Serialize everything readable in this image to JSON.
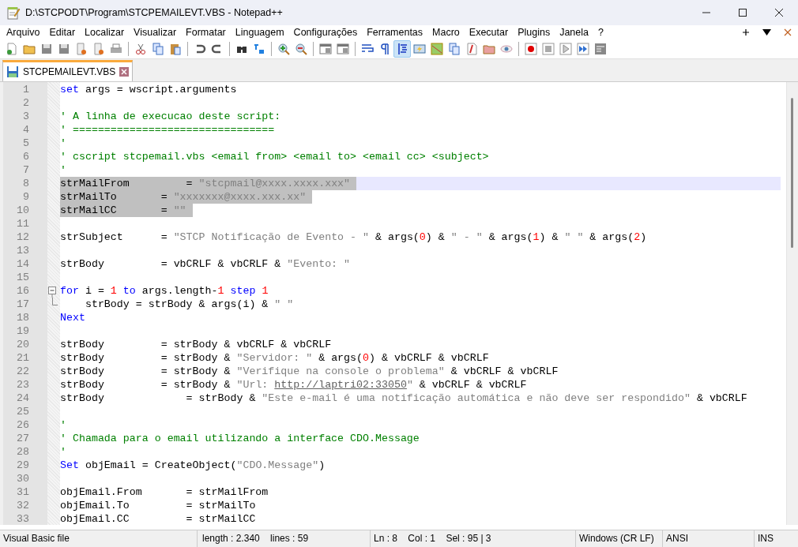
{
  "window": {
    "title": "D:\\STCPODT\\Program\\STCPEMAILEVT.VBS - Notepad++"
  },
  "menu": [
    {
      "label": "Arquivo"
    },
    {
      "label": "Editar"
    },
    {
      "label": "Localizar"
    },
    {
      "label": "Visualizar"
    },
    {
      "label": "Formatar"
    },
    {
      "label": "Linguagem"
    },
    {
      "label": "Configurações"
    },
    {
      "label": "Ferramentas"
    },
    {
      "label": "Macro"
    },
    {
      "label": "Executar"
    },
    {
      "label": "Plugins"
    },
    {
      "label": "Janela"
    },
    {
      "label": "?"
    }
  ],
  "toolbar": [
    {
      "pressed": false
    },
    {
      "pressed": false
    },
    {
      "pressed": false
    },
    {
      "pressed": false
    },
    {
      "pressed": false
    },
    {
      "pressed": false
    },
    {
      "pressed": false
    },
    {
      "pressed": false
    },
    {
      "pressed": false
    },
    {
      "pressed": false
    },
    {
      "pressed": false
    },
    {
      "pressed": false
    },
    {
      "pressed": false
    },
    {
      "pressed": false
    },
    {
      "pressed": false
    },
    {
      "pressed": false
    },
    {
      "pressed": false
    },
    {
      "pressed": false
    },
    {
      "pressed": false
    },
    {
      "pressed": false
    },
    {
      "pressed": true
    },
    {
      "pressed": false
    },
    {
      "pressed": false
    },
    {
      "pressed": false
    },
    {
      "pressed": false
    },
    {
      "pressed": false
    },
    {
      "pressed": false
    },
    {
      "pressed": false
    },
    {
      "pressed": false
    },
    {
      "pressed": false
    },
    {
      "pressed": false
    },
    {
      "pressed": false
    }
  ],
  "tabs": [
    {
      "label": "STCPEMAILEVT.VBS",
      "selected": true
    }
  ],
  "lines": [
    {
      "n": "1",
      "selected": false,
      "current": false,
      "tokens": [
        {
          "kind": "kw",
          "text": "set"
        },
        {
          "kind": "txt",
          "text": " args = wscript.arguments"
        }
      ]
    },
    {
      "n": "2",
      "selected": false,
      "current": false
    },
    {
      "n": "3",
      "selected": false,
      "current": false,
      "tokens": [
        {
          "kind": "cmt",
          "text": "' A linha de execucao deste script:"
        }
      ]
    },
    {
      "n": "4",
      "selected": false,
      "current": false,
      "tokens": [
        {
          "kind": "cmt",
          "text": "' ================================"
        }
      ]
    },
    {
      "n": "5",
      "selected": false,
      "current": false,
      "tokens": [
        {
          "kind": "cmt",
          "text": "'"
        }
      ]
    },
    {
      "n": "6",
      "selected": false,
      "current": false,
      "tokens": [
        {
          "kind": "cmt",
          "text": "' cscript stcpemail.vbs <email from> <email to> <email cc> <subject>"
        }
      ]
    },
    {
      "n": "7",
      "selected": false,
      "current": false,
      "tokens": [
        {
          "kind": "cmt",
          "text": "'"
        }
      ]
    },
    {
      "n": "8",
      "selected": true,
      "current": true,
      "tokens": [
        {
          "kind": "txt",
          "text": "strMailFrom         = "
        },
        {
          "kind": "str",
          "text": "\"stcpmail@xxxx.xxxx.xxx\""
        }
      ]
    },
    {
      "n": "9",
      "selected": true,
      "current": false,
      "tokens": [
        {
          "kind": "txt",
          "text": "strMailTo       = "
        },
        {
          "kind": "str",
          "text": "\"xxxxxxx@xxxx.xxx.xx\""
        }
      ]
    },
    {
      "n": "10",
      "selected": true,
      "current": false,
      "tokens": [
        {
          "kind": "txt",
          "text": "strMailCC       = "
        },
        {
          "kind": "str",
          "text": "\"\""
        }
      ]
    },
    {
      "n": "11",
      "selected": false,
      "current": false
    },
    {
      "n": "12",
      "selected": false,
      "current": false,
      "tokens": [
        {
          "kind": "txt",
          "text": "strSubject      = "
        },
        {
          "kind": "str",
          "text": "\"STCP Notificação de Evento - \""
        },
        {
          "kind": "txt",
          "text": " & args("
        },
        {
          "kind": "num",
          "text": "0"
        },
        {
          "kind": "txt",
          "text": ") & "
        },
        {
          "kind": "str",
          "text": "\" - \""
        },
        {
          "kind": "txt",
          "text": " & args("
        },
        {
          "kind": "num",
          "text": "1"
        },
        {
          "kind": "txt",
          "text": ") & "
        },
        {
          "kind": "str",
          "text": "\" \""
        },
        {
          "kind": "txt",
          "text": " & args("
        },
        {
          "kind": "num",
          "text": "2"
        },
        {
          "kind": "txt",
          "text": ")"
        }
      ]
    },
    {
      "n": "13",
      "selected": false,
      "current": false
    },
    {
      "n": "14",
      "selected": false,
      "current": false,
      "tokens": [
        {
          "kind": "txt",
          "text": "strBody         = vbCRLF & vbCRLF & "
        },
        {
          "kind": "str",
          "text": "\"Evento: \""
        }
      ]
    },
    {
      "n": "15",
      "selected": false,
      "current": false
    },
    {
      "n": "16",
      "selected": false,
      "current": false,
      "kind": "fold_start",
      "tokens": [
        {
          "kind": "kw",
          "text": "for"
        },
        {
          "kind": "txt",
          "text": " i = "
        },
        {
          "kind": "num",
          "text": "1"
        },
        {
          "kind": "kw",
          "text": " to"
        },
        {
          "kind": "txt",
          "text": " args.length-"
        },
        {
          "kind": "num",
          "text": "1"
        },
        {
          "kind": "kw",
          "text": " step "
        },
        {
          "kind": "num",
          "text": "1"
        }
      ]
    },
    {
      "n": "17",
      "selected": false,
      "current": false,
      "kind": "fold_end",
      "tokens": [
        {
          "kind": "txt",
          "text": "    strBody = strBody & args(i) & "
        },
        {
          "kind": "str",
          "text": "\" \""
        }
      ]
    },
    {
      "n": "18",
      "selected": false,
      "current": false,
      "tokens": [
        {
          "kind": "kw",
          "text": "Next"
        }
      ]
    },
    {
      "n": "19",
      "selected": false,
      "current": false
    },
    {
      "n": "20",
      "selected": false,
      "current": false,
      "tokens": [
        {
          "kind": "txt",
          "text": "strBody         = strBody & vbCRLF & vbCRLF"
        }
      ]
    },
    {
      "n": "21",
      "selected": false,
      "current": false,
      "tokens": [
        {
          "kind": "txt",
          "text": "strBody         = strBody & "
        },
        {
          "kind": "str",
          "text": "\"Servidor: \""
        },
        {
          "kind": "txt",
          "text": " & args("
        },
        {
          "kind": "num",
          "text": "0"
        },
        {
          "kind": "txt",
          "text": ") & vbCRLF & vbCRLF"
        }
      ]
    },
    {
      "n": "22",
      "selected": false,
      "current": false,
      "tokens": [
        {
          "kind": "txt",
          "text": "strBody         = strBody & "
        },
        {
          "kind": "str",
          "text": "\"Verifique na console o problema\""
        },
        {
          "kind": "txt",
          "text": " & vbCRLF & vbCRLF"
        }
      ]
    },
    {
      "n": "23",
      "selected": false,
      "current": false,
      "tokens": [
        {
          "kind": "txt",
          "text": "strBody         = strBody & "
        },
        {
          "kind": "str",
          "text": "\"Url: "
        },
        {
          "kind": "link",
          "text": "http://laptri02:33050"
        },
        {
          "kind": "str",
          "text": "\""
        },
        {
          "kind": "txt",
          "text": " & vbCRLF & vbCRLF"
        }
      ]
    },
    {
      "n": "24",
      "selected": false,
      "current": false,
      "tokens": [
        {
          "kind": "txt",
          "text": "strBody             = strBody & "
        },
        {
          "kind": "str",
          "text": "\"Este e-mail é uma notificação automática e não deve ser respondido\""
        },
        {
          "kind": "txt",
          "text": " & vbCRLF"
        }
      ]
    },
    {
      "n": "25",
      "selected": false,
      "current": false
    },
    {
      "n": "26",
      "selected": false,
      "current": false,
      "tokens": [
        {
          "kind": "cmt",
          "text": "'"
        }
      ]
    },
    {
      "n": "27",
      "selected": false,
      "current": false,
      "tokens": [
        {
          "kind": "cmt",
          "text": "' Chamada para o email utilizando a interface CDO.Message"
        }
      ]
    },
    {
      "n": "28",
      "selected": false,
      "current": false,
      "tokens": [
        {
          "kind": "cmt",
          "text": "'"
        }
      ]
    },
    {
      "n": "29",
      "selected": false,
      "current": false,
      "tokens": [
        {
          "kind": "kw",
          "text": "Set"
        },
        {
          "kind": "txt",
          "text": " objEmail = CreateObject("
        },
        {
          "kind": "str",
          "text": "\"CDO.Message\""
        },
        {
          "kind": "txt",
          "text": ")"
        }
      ]
    },
    {
      "n": "30",
      "selected": false,
      "current": false
    },
    {
      "n": "31",
      "selected": false,
      "current": false,
      "tokens": [
        {
          "kind": "txt",
          "text": "objEmail.From       = strMailFrom"
        }
      ]
    },
    {
      "n": "32",
      "selected": false,
      "current": false,
      "tokens": [
        {
          "kind": "txt",
          "text": "objEmail.To         = strMailTo"
        }
      ]
    },
    {
      "n": "33",
      "selected": false,
      "current": false,
      "tokens": [
        {
          "kind": "txt",
          "text": "objEmail.CC         = strMailCC"
        }
      ]
    }
  ],
  "status_bar": [
    {
      "text": "Visual Basic file"
    },
    {
      "text": "length : 2.340    lines : 59"
    },
    {
      "text": "Ln : 8    Col : 1    Sel : 95 | 3"
    },
    {
      "text": "Windows (CR LF)"
    },
    {
      "text": "ANSI"
    },
    {
      "text": "INS"
    }
  ]
}
